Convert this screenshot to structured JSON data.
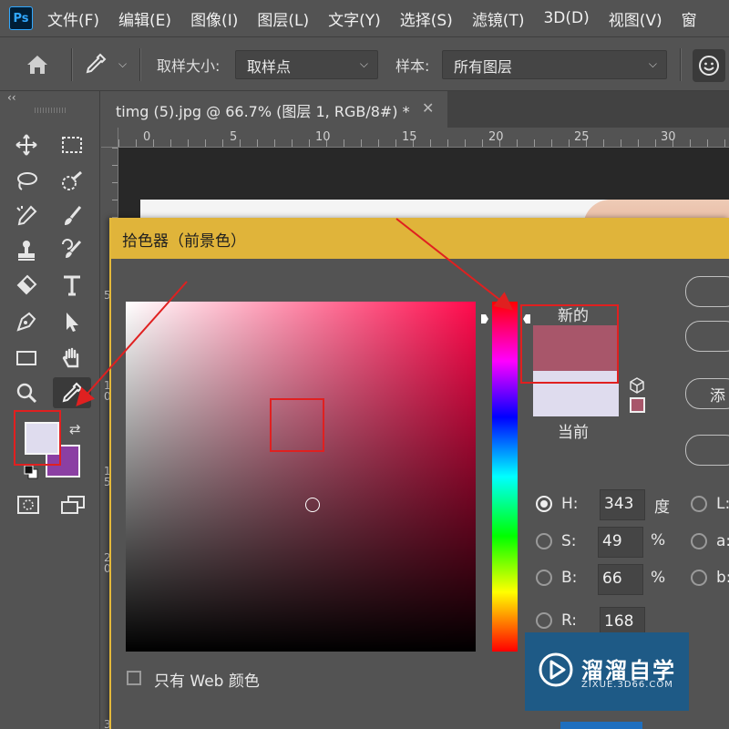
{
  "app": {
    "logo": "Ps"
  },
  "menu": {
    "items": [
      "文件(F)",
      "编辑(E)",
      "图像(I)",
      "图层(L)",
      "文字(Y)",
      "选择(S)",
      "滤镜(T)",
      "3D(D)",
      "视图(V)",
      "窗"
    ]
  },
  "options_bar": {
    "sample_size_label": "取样大小:",
    "sample_size_value": "取样点",
    "sample_label": "样本:",
    "sample_value": "所有图层"
  },
  "toolbar": {
    "collapse": "‹‹",
    "foreground_color": "#dfdcee",
    "background_color": "#8b3fa3"
  },
  "document": {
    "tab_title": "timg (5).jpg @ 66.7% (图层 1, RGB/8#) *",
    "close": "✕"
  },
  "ruler": {
    "h_labels": [
      "0",
      "5",
      "10",
      "15",
      "20",
      "25",
      "30"
    ],
    "v_labels": [
      "5",
      "1",
      "0",
      "1",
      "5",
      "2",
      "0",
      "3"
    ]
  },
  "color_picker": {
    "title": "拾色器（前景色）",
    "new_label": "新的",
    "current_label": "当前",
    "new_color": "#a8566a",
    "current_color": "#dfdcee",
    "add_button": "添",
    "web_only_label": "只有 Web 颜色",
    "fields": {
      "H": {
        "label": "H:",
        "value": "343",
        "unit": "度"
      },
      "S": {
        "label": "S:",
        "value": "49",
        "unit": "%"
      },
      "B": {
        "label": "B:",
        "value": "66",
        "unit": "%"
      },
      "R": {
        "label": "R:",
        "value": "168"
      }
    },
    "lab_labels": {
      "L": "L:",
      "a": "a:",
      "b": "b:"
    }
  },
  "watermark": {
    "title": "溜溜自学",
    "url": "ZIXUE.3D66.COM"
  },
  "icons": [
    "home-icon",
    "eyedropper-icon",
    "face-icon",
    "move-icon",
    "marquee-icon",
    "lasso-icon",
    "quick-select-icon",
    "healing-icon",
    "brush-icon",
    "stamp-icon",
    "history-brush-icon",
    "eraser-icon",
    "text-icon",
    "pen-icon",
    "path-select-icon",
    "rectangle-icon",
    "hand-icon",
    "zoom-icon",
    "swap-icon",
    "cube-icon"
  ]
}
